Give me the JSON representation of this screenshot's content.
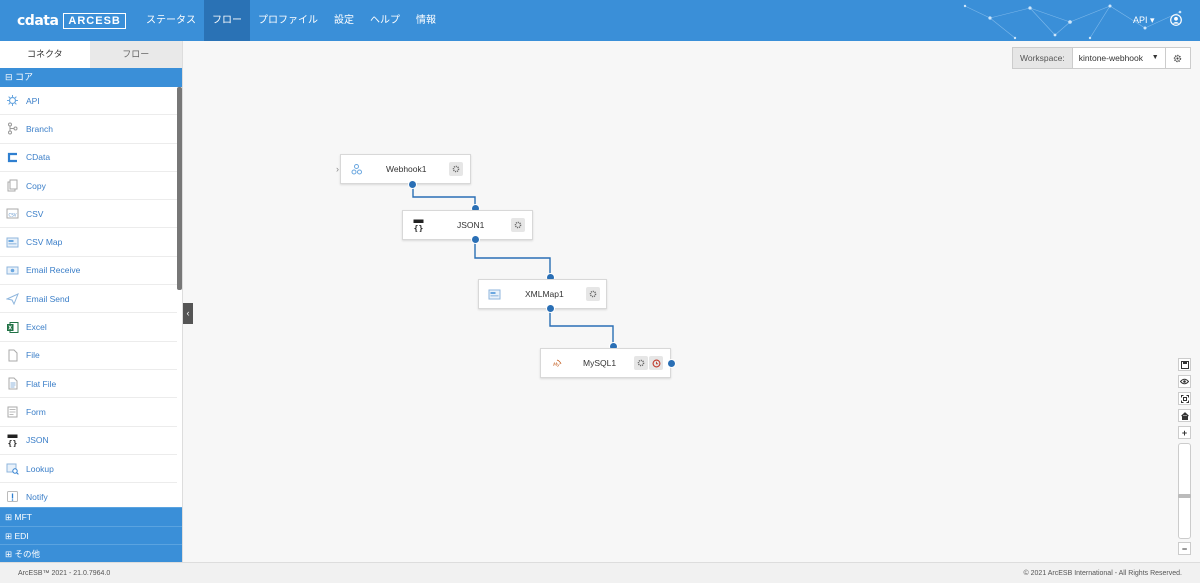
{
  "header": {
    "logo_brand": "cdata",
    "logo_product": "ARCESB",
    "nav": [
      {
        "label": "ステータス"
      },
      {
        "label": "フロー"
      },
      {
        "label": "プロファイル"
      },
      {
        "label": "設定"
      },
      {
        "label": "ヘルプ"
      },
      {
        "label": "情報"
      }
    ],
    "api_menu": "API ▾",
    "accent_color": "#3a8fd8"
  },
  "sidebar": {
    "tabs": [
      {
        "label": "コネクタ"
      },
      {
        "label": "フロー"
      }
    ],
    "category_open": "⊟ コア",
    "items": [
      {
        "label": "API",
        "icon": "api-icon"
      },
      {
        "label": "Branch",
        "icon": "branch-icon"
      },
      {
        "label": "CData",
        "icon": "cdata-icon"
      },
      {
        "label": "Copy",
        "icon": "copy-icon"
      },
      {
        "label": "CSV",
        "icon": "csv-icon"
      },
      {
        "label": "CSV Map",
        "icon": "csv-map-icon"
      },
      {
        "label": "Email Receive",
        "icon": "email-receive-icon"
      },
      {
        "label": "Email Send",
        "icon": "email-send-icon"
      },
      {
        "label": "Excel",
        "icon": "excel-icon"
      },
      {
        "label": "File",
        "icon": "file-icon"
      },
      {
        "label": "Flat File",
        "icon": "flat-file-icon"
      },
      {
        "label": "Form",
        "icon": "form-icon"
      },
      {
        "label": "JSON",
        "icon": "json-icon"
      },
      {
        "label": "Lookup",
        "icon": "lookup-icon"
      },
      {
        "label": "Notify",
        "icon": "notify-icon"
      }
    ],
    "categories_closed": [
      {
        "label": "⊞ MFT"
      },
      {
        "label": "⊞ EDI"
      },
      {
        "label": "⊞ その他"
      }
    ]
  },
  "workspace": {
    "label": "Workspace:",
    "value": "kintone-webhook"
  },
  "flow": {
    "nodes": [
      {
        "label": "Webhook1",
        "icon": "webhook-icon"
      },
      {
        "label": "JSON1",
        "icon": "json-icon"
      },
      {
        "label": "XMLMap1",
        "icon": "xmlmap-icon"
      },
      {
        "label": "MySQL1",
        "icon": "mysql-icon"
      }
    ]
  },
  "zoom_controls": [
    "save-icon",
    "eye-icon",
    "fit-icon",
    "home-icon",
    "zoom-in-icon",
    "zoom-out-icon"
  ],
  "footer": {
    "left": "ArcESB™ 2021 - 21.0.7964.0",
    "right": "© 2021 ArcESB International - All Rights Reserved."
  }
}
